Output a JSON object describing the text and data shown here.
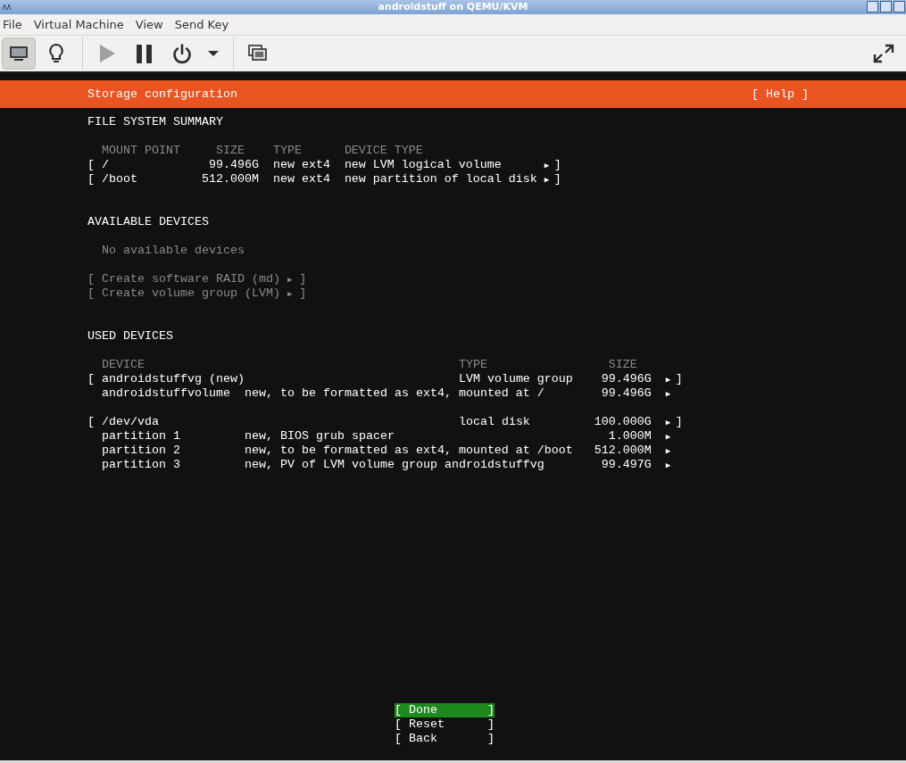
{
  "window": {
    "title": "androidstuff on QEMU/KVM"
  },
  "menu": [
    "File",
    "Virtual Machine",
    "View",
    "Send Key"
  ],
  "toolbar": [
    {
      "kind": "console",
      "selected": true
    },
    {
      "kind": "details",
      "selected": false
    },
    {
      "kind": "separator"
    },
    {
      "kind": "run",
      "disabled": true
    },
    {
      "kind": "pause",
      "disabled": false
    },
    {
      "kind": "power",
      "disabled": false
    },
    {
      "kind": "dropdown",
      "disabled": false
    },
    {
      "kind": "separator"
    },
    {
      "kind": "snapshots",
      "disabled": false
    },
    {
      "kind": "fullscreen",
      "disabled": false
    }
  ],
  "installer": {
    "title": "Storage configuration",
    "help": "[ Help ]",
    "file_system_summary": {
      "heading": "FILE SYSTEM SUMMARY",
      "columns": [
        "MOUNT POINT",
        "SIZE",
        "TYPE",
        "DEVICE TYPE"
      ],
      "rows": [
        {
          "open": "[",
          "mount_point": "/",
          "size": "99.496G",
          "type": "new ext4",
          "device_type": "new LVM logical volume",
          "arrow": "▶",
          "close": "]"
        },
        {
          "open": "[",
          "mount_point": "/boot",
          "size": "512.000M",
          "type": "new ext4",
          "device_type": "new partition of local disk",
          "arrow": "▶",
          "close": "]"
        }
      ]
    },
    "available_devices": {
      "heading": "AVAILABLE DEVICES",
      "message": "No available devices",
      "actions": [
        {
          "open": "[",
          "label": "Create software RAID (md)",
          "arrow": "▶",
          "close": "]",
          "disabled": true
        },
        {
          "open": "[",
          "label": "Create volume group (LVM)",
          "arrow": "▶",
          "close": "]",
          "disabled": true
        }
      ]
    },
    "used_devices": {
      "heading": "USED DEVICES",
      "columns": [
        "DEVICE",
        "TYPE",
        "SIZE"
      ],
      "groups": [
        {
          "open": "[",
          "device": "androidstuffvg (new)",
          "type": "LVM volume group",
          "size": "99.496G",
          "arrow": "▶",
          "close": "]",
          "children": [
            {
              "device": "androidstuffvolume",
              "description": "new, to be formatted as ext4, mounted at /",
              "size": "99.496G",
              "arrow": "▶"
            }
          ]
        },
        {
          "open": "[",
          "device": "/dev/vda",
          "type": "local disk",
          "size": "100.000G",
          "arrow": "▶",
          "close": "]",
          "children": [
            {
              "device": "partition 1",
              "description": "new, BIOS grub spacer",
              "size": "1.000M",
              "arrow": "▶"
            },
            {
              "device": "partition 2",
              "description": "new, to be formatted as ext4, mounted at /boot",
              "size": "512.000M",
              "arrow": "▶"
            },
            {
              "device": "partition 3",
              "description": "new, PV of LVM volume group androidstuffvg",
              "size": "99.497G",
              "arrow": "▶"
            }
          ]
        }
      ]
    },
    "buttons": [
      {
        "open": "[",
        "label": "Done",
        "close": "]",
        "selected": true
      },
      {
        "open": "[",
        "label": "Reset",
        "close": "]",
        "selected": false
      },
      {
        "open": "[",
        "label": "Back",
        "close": "]",
        "selected": false
      }
    ]
  }
}
